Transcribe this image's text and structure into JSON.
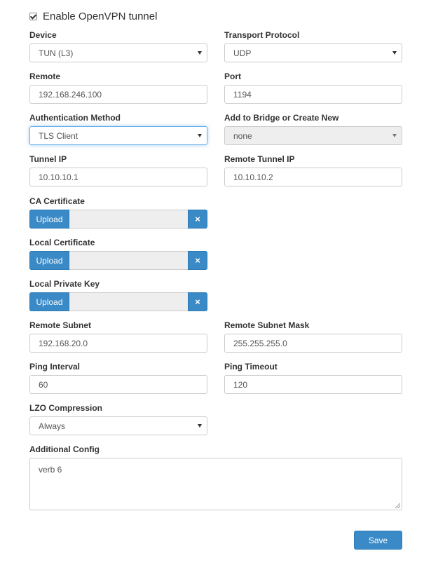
{
  "enable": {
    "label": "Enable OpenVPN tunnel",
    "checked": true
  },
  "device": {
    "label": "Device",
    "value": "TUN (L3)"
  },
  "transport": {
    "label": "Transport Protocol",
    "value": "UDP"
  },
  "remote": {
    "label": "Remote",
    "value": "192.168.246.100"
  },
  "port": {
    "label": "Port",
    "value": "1194"
  },
  "auth": {
    "label": "Authentication Method",
    "value": "TLS Client"
  },
  "bridge": {
    "label": "Add to Bridge or Create New",
    "value": "none"
  },
  "tunnel_ip": {
    "label": "Tunnel IP",
    "value": "10.10.10.1"
  },
  "remote_tunnel_ip": {
    "label": "Remote Tunnel IP",
    "value": "10.10.10.2"
  },
  "ca_cert": {
    "label": "CA Certificate",
    "upload_label": "Upload",
    "clear_label": "×"
  },
  "local_cert": {
    "label": "Local Certificate",
    "upload_label": "Upload",
    "clear_label": "×"
  },
  "local_key": {
    "label": "Local Private Key",
    "upload_label": "Upload",
    "clear_label": "×"
  },
  "remote_subnet": {
    "label": "Remote Subnet",
    "value": "192.168.20.0"
  },
  "remote_subnet_mask": {
    "label": "Remote Subnet Mask",
    "value": "255.255.255.0"
  },
  "ping_interval": {
    "label": "Ping Interval",
    "value": "60"
  },
  "ping_timeout": {
    "label": "Ping Timeout",
    "value": "120"
  },
  "lzo": {
    "label": "LZO Compression",
    "value": "Always"
  },
  "additional_config": {
    "label": "Additional Config",
    "value": "verb 6"
  },
  "save_label": "Save",
  "colors": {
    "primary": "#3a8ac7",
    "focus": "#66afe9",
    "disabled_bg": "#eeeeee"
  }
}
